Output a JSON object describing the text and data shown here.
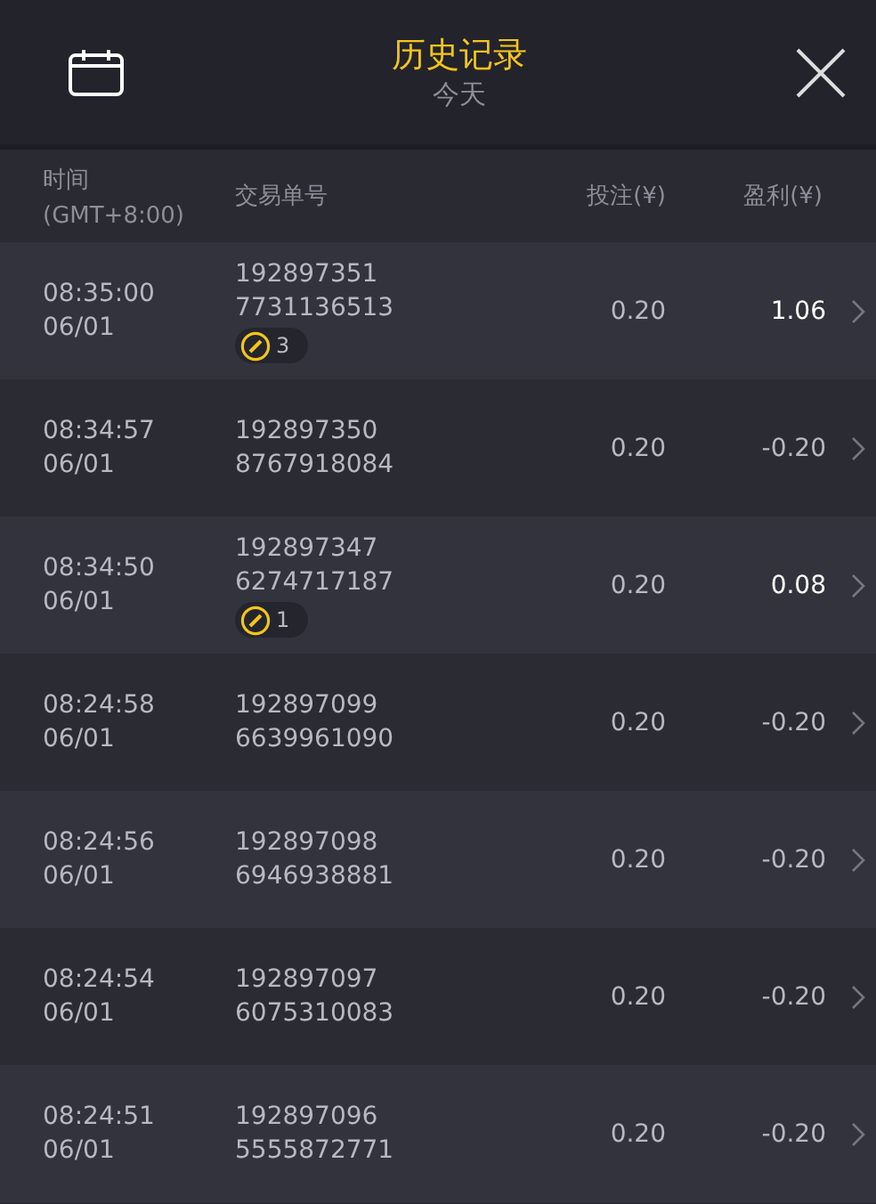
{
  "header": {
    "title": "历史记录",
    "subtitle": "今天"
  },
  "columns": {
    "time": "时间",
    "timezone": "(GMT+8:00)",
    "order": "交易单号",
    "bet": "投注(¥)",
    "profit": "盈利(¥)"
  },
  "rows": [
    {
      "time": "08:35:00",
      "date": "06/01",
      "id1": "192897351",
      "id2": "7731136513",
      "badge": "3",
      "bet": "0.20",
      "profit": "1.06",
      "win": true
    },
    {
      "time": "08:34:57",
      "date": "06/01",
      "id1": "192897350",
      "id2": "8767918084",
      "bet": "0.20",
      "profit": "-0.20",
      "win": false
    },
    {
      "time": "08:34:50",
      "date": "06/01",
      "id1": "192897347",
      "id2": "6274717187",
      "badge": "1",
      "bet": "0.20",
      "profit": "0.08",
      "win": true
    },
    {
      "time": "08:24:58",
      "date": "06/01",
      "id1": "192897099",
      "id2": "6639961090",
      "bet": "0.20",
      "profit": "-0.20",
      "win": false
    },
    {
      "time": "08:24:56",
      "date": "06/01",
      "id1": "192897098",
      "id2": "6946938881",
      "bet": "0.20",
      "profit": "-0.20",
      "win": false
    },
    {
      "time": "08:24:54",
      "date": "06/01",
      "id1": "192897097",
      "id2": "6075310083",
      "bet": "0.20",
      "profit": "-0.20",
      "win": false
    },
    {
      "time": "08:24:51",
      "date": "06/01",
      "id1": "192897096",
      "id2": "5555872771",
      "bet": "0.20",
      "profit": "-0.20",
      "win": false
    }
  ]
}
